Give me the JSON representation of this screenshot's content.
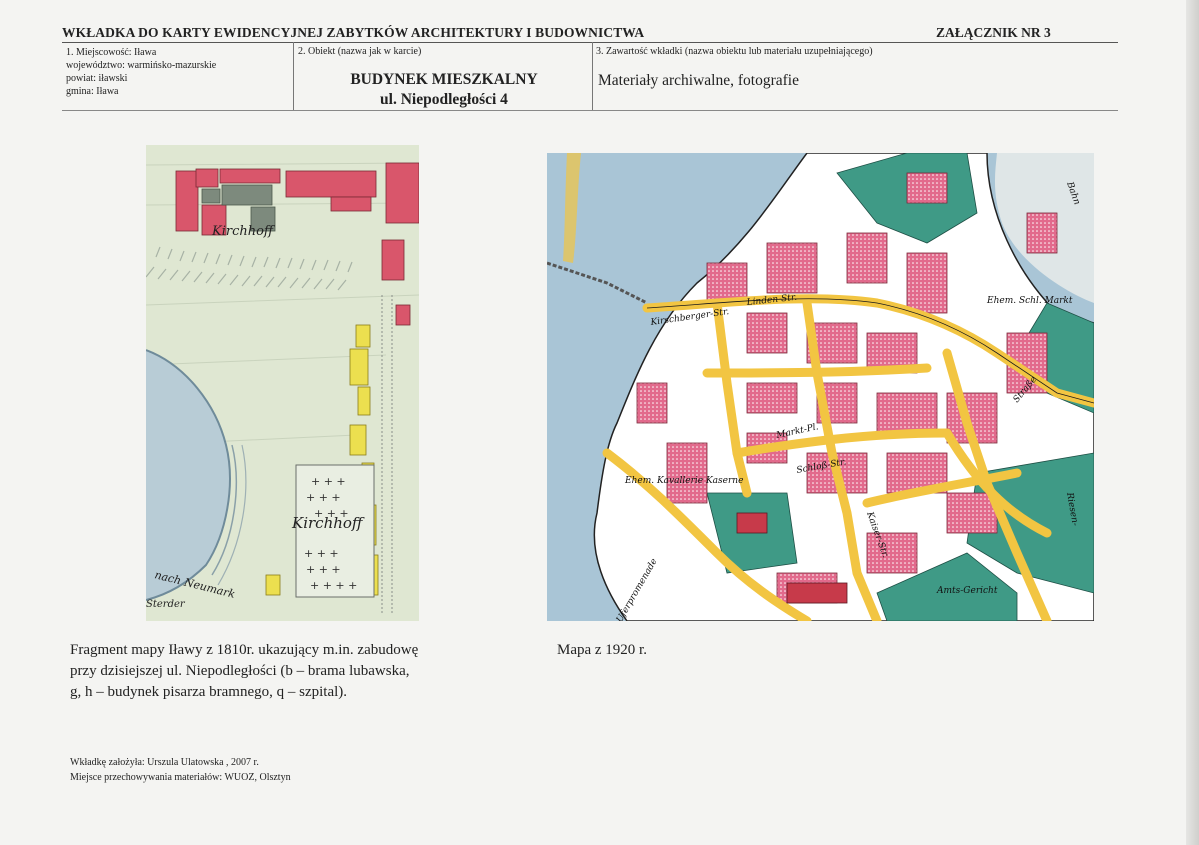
{
  "header": {
    "title": "WKŁADKA DO KARTY EWIDENCYJNEJ ZABYTKÓW ARCHITEKTURY I BUDOWNICTWA",
    "annex": "ZAŁĄCZNIK NR 3"
  },
  "cell1": {
    "line1": "1. Miejscowość: Iława",
    "line2": "województwo: warmińsko-mazurskie",
    "line3": "powiat: iławski",
    "line4": "gmina: Iława"
  },
  "cell2": {
    "label": "2. Obiekt (nazwa jak w karcie)",
    "name": "BUDYNEK MIESZKALNY",
    "street": "ul. Niepodległości  4"
  },
  "cell3": {
    "label": "3. Zawartość wkładki (nazwa obiektu lub materiału uzupełniającego)",
    "value": "Materiały archiwalne, fotografie"
  },
  "map1": {
    "labels": [
      "Kirchhoff",
      "Kirchhoff",
      "nach Neumark",
      "Sterder"
    ],
    "caption": [
      "Fragment mapy Iławy z 1810r. ukazujący m.in. zabudowę",
      "przy dzisiejszej ul. Niepodległości (b – brama lubawska,",
      "g, h – budynek pisarza bramnego, q – szpital)."
    ]
  },
  "map2": {
    "labels": [
      "Kirschberger-Str.",
      "Linden-Str.",
      "Ehem. Schl. Markt",
      "Markt-Pl.",
      "Schloß-Str.",
      "Ehem. Kavallerie Kaserne",
      "Kaiser-Str.",
      "Uferpromenade",
      "Amts-Gericht",
      "Riesen-",
      "Straße",
      "Bahn"
    ],
    "caption": "Mapa z 1920 r."
  },
  "footer": {
    "author": "Wkładkę założyła: Urszula Ulatowska , 2007 r.",
    "storage": "Miejsce przechowywania materiałów: WUOZ, Olsztyn"
  },
  "colors": {
    "old_map_bg": "#dfe7d2",
    "old_map_pink": "#d9566b",
    "old_map_yellow": "#ecdf4f",
    "old_map_lake": "#b8ccd6",
    "new_map_water": "#a9c5d6",
    "new_map_street": "#f2c542",
    "new_map_teal": "#3f9a86",
    "new_map_pink": "#e26a8c"
  }
}
